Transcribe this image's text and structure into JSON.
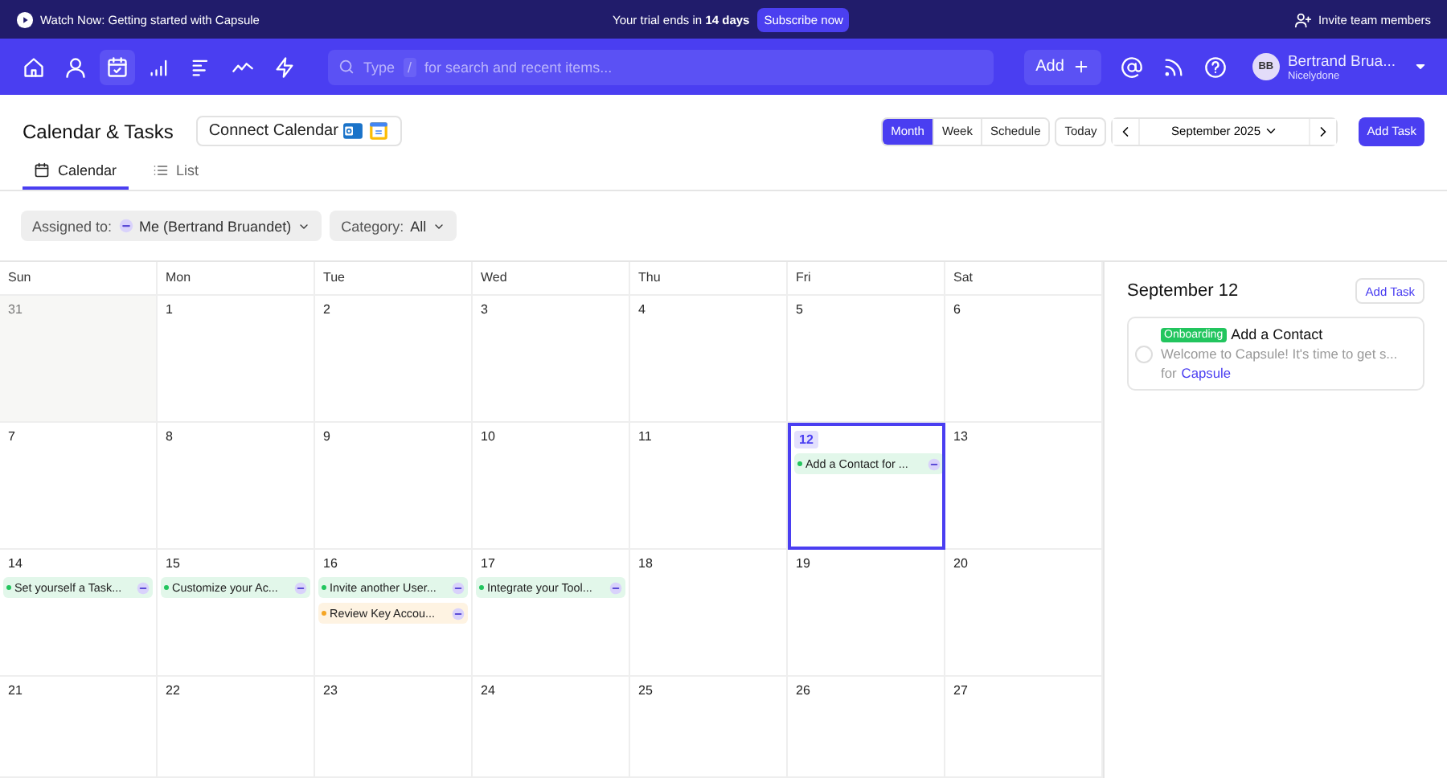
{
  "banner": {
    "watch": "Watch Now: Getting started with Capsule",
    "trial": "Your trial ends in **14 days**",
    "subscribe": "Subscribe now",
    "invite": "Invite team members"
  },
  "nav": {
    "items": [
      {
        "selected": false
      },
      {
        "selected": false
      },
      {
        "selected": true
      },
      {
        "selected": false
      },
      {
        "selected": false
      },
      {
        "selected": false
      },
      {
        "selected": false
      }
    ],
    "search": {
      "placeholder": "Type",
      "key": "/",
      "hint": "for search and recent items..."
    },
    "add": "Add",
    "user": {
      "initials": "BB",
      "name": "Bertrand Brua...",
      "org": "Nicelydone"
    }
  },
  "header": {
    "title": "Calendar & Tasks",
    "connect": "Connect Calendar",
    "views": [
      {
        "label": "Month",
        "selected": true
      },
      {
        "label": "Week",
        "selected": false
      },
      {
        "label": "Schedule",
        "selected": false
      }
    ],
    "today": "Today",
    "period": "September 2025",
    "add_task": "Add Task"
  },
  "tabs": [
    {
      "label": "Calendar",
      "selected": true
    },
    {
      "label": "List",
      "selected": false
    }
  ],
  "filters": [
    {
      "label": "Assigned to:",
      "value": "Me (Bertrand Bruandet)",
      "avatar": true
    },
    {
      "label": "Category:",
      "value": "All",
      "avatar": false
    }
  ],
  "calendar": {
    "weekdays": [
      "Sun",
      "Mon",
      "Tue",
      "Wed",
      "Thu",
      "Fri",
      "Sat"
    ],
    "weeks": [
      [
        {
          "day": "31",
          "outside": true,
          "selected": false
        },
        {
          "day": "1",
          "outside": false,
          "selected": false
        },
        {
          "day": "2",
          "outside": false,
          "selected": false
        },
        {
          "day": "3",
          "outside": false,
          "selected": false
        },
        {
          "day": "4",
          "outside": false,
          "selected": false
        },
        {
          "day": "5",
          "outside": false,
          "selected": false
        },
        {
          "day": "6",
          "outside": false,
          "selected": false
        }
      ],
      [
        {
          "day": "7",
          "outside": false,
          "selected": false
        },
        {
          "day": "8",
          "outside": false,
          "selected": false
        },
        {
          "day": "9",
          "outside": false,
          "selected": false
        },
        {
          "day": "10",
          "outside": false,
          "selected": false
        },
        {
          "day": "11",
          "outside": false,
          "selected": false
        },
        {
          "day": "12",
          "outside": false,
          "selected": true,
          "tasks": [
            {
              "title": "Add a Contact for ...",
              "color": "#22c55e"
            }
          ]
        },
        {
          "day": "13",
          "outside": false,
          "selected": false
        }
      ],
      [
        {
          "day": "14",
          "outside": false,
          "selected": false,
          "tasks": [
            {
              "title": "Set yourself a Task...",
              "color": "#22c55e"
            }
          ]
        },
        {
          "day": "15",
          "outside": false,
          "selected": false,
          "tasks": [
            {
              "title": "Customize your Ac...",
              "color": "#22c55e"
            }
          ]
        },
        {
          "day": "16",
          "outside": false,
          "selected": false,
          "tasks": [
            {
              "title": "Invite another User...",
              "color": "#22c55e"
            },
            {
              "title": "Review Key Accou...",
              "color": "#f5a524"
            }
          ]
        },
        {
          "day": "17",
          "outside": false,
          "selected": false,
          "tasks": [
            {
              "title": "Integrate your Tool...",
              "color": "#22c55e"
            }
          ]
        },
        {
          "day": "18",
          "outside": false,
          "selected": false
        },
        {
          "day": "19",
          "outside": false,
          "selected": false
        },
        {
          "day": "20",
          "outside": false,
          "selected": false
        }
      ],
      [
        {
          "day": "21",
          "outside": false,
          "selected": false
        },
        {
          "day": "22",
          "outside": false,
          "selected": false
        },
        {
          "day": "23",
          "outside": false,
          "selected": false
        },
        {
          "day": "24",
          "outside": false,
          "selected": false
        },
        {
          "day": "25",
          "outside": false,
          "selected": false
        },
        {
          "day": "26",
          "outside": false,
          "selected": false
        },
        {
          "day": "27",
          "outside": false,
          "selected": false
        }
      ]
    ]
  },
  "panel": {
    "date": "September 12",
    "add_task": "Add Task",
    "tasks": [
      {
        "tag": "Onboarding",
        "title": "Add a Contact",
        "description": "Welcome to Capsule! It's time to get s...",
        "for": "for",
        "link": "Capsule",
        "done": false
      }
    ]
  }
}
